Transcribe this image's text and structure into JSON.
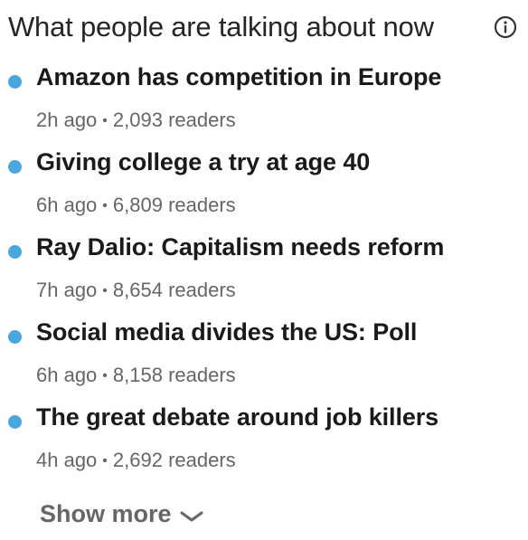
{
  "header": {
    "title": "What people are talking about now",
    "info_icon": "info-circle-icon"
  },
  "colors": {
    "bullet": "#4aa7dd",
    "meta": "#666666",
    "headline": "#1a1a1a"
  },
  "items": [
    {
      "headline": "Amazon has competition in Europe",
      "time": "2h ago",
      "readers": "2,093 readers"
    },
    {
      "headline": "Giving college a try at age 40",
      "time": "6h ago",
      "readers": "6,809 readers"
    },
    {
      "headline": "Ray Dalio: Capitalism needs reform",
      "time": "7h ago",
      "readers": "8,654 readers"
    },
    {
      "headline": "Social media divides the US: Poll",
      "time": "6h ago",
      "readers": "8,158 readers"
    },
    {
      "headline": "The great debate around job killers",
      "time": "4h ago",
      "readers": "2,692 readers"
    }
  ],
  "separator": "•",
  "show_more": {
    "label": "Show more",
    "icon": "chevron-down-icon"
  }
}
